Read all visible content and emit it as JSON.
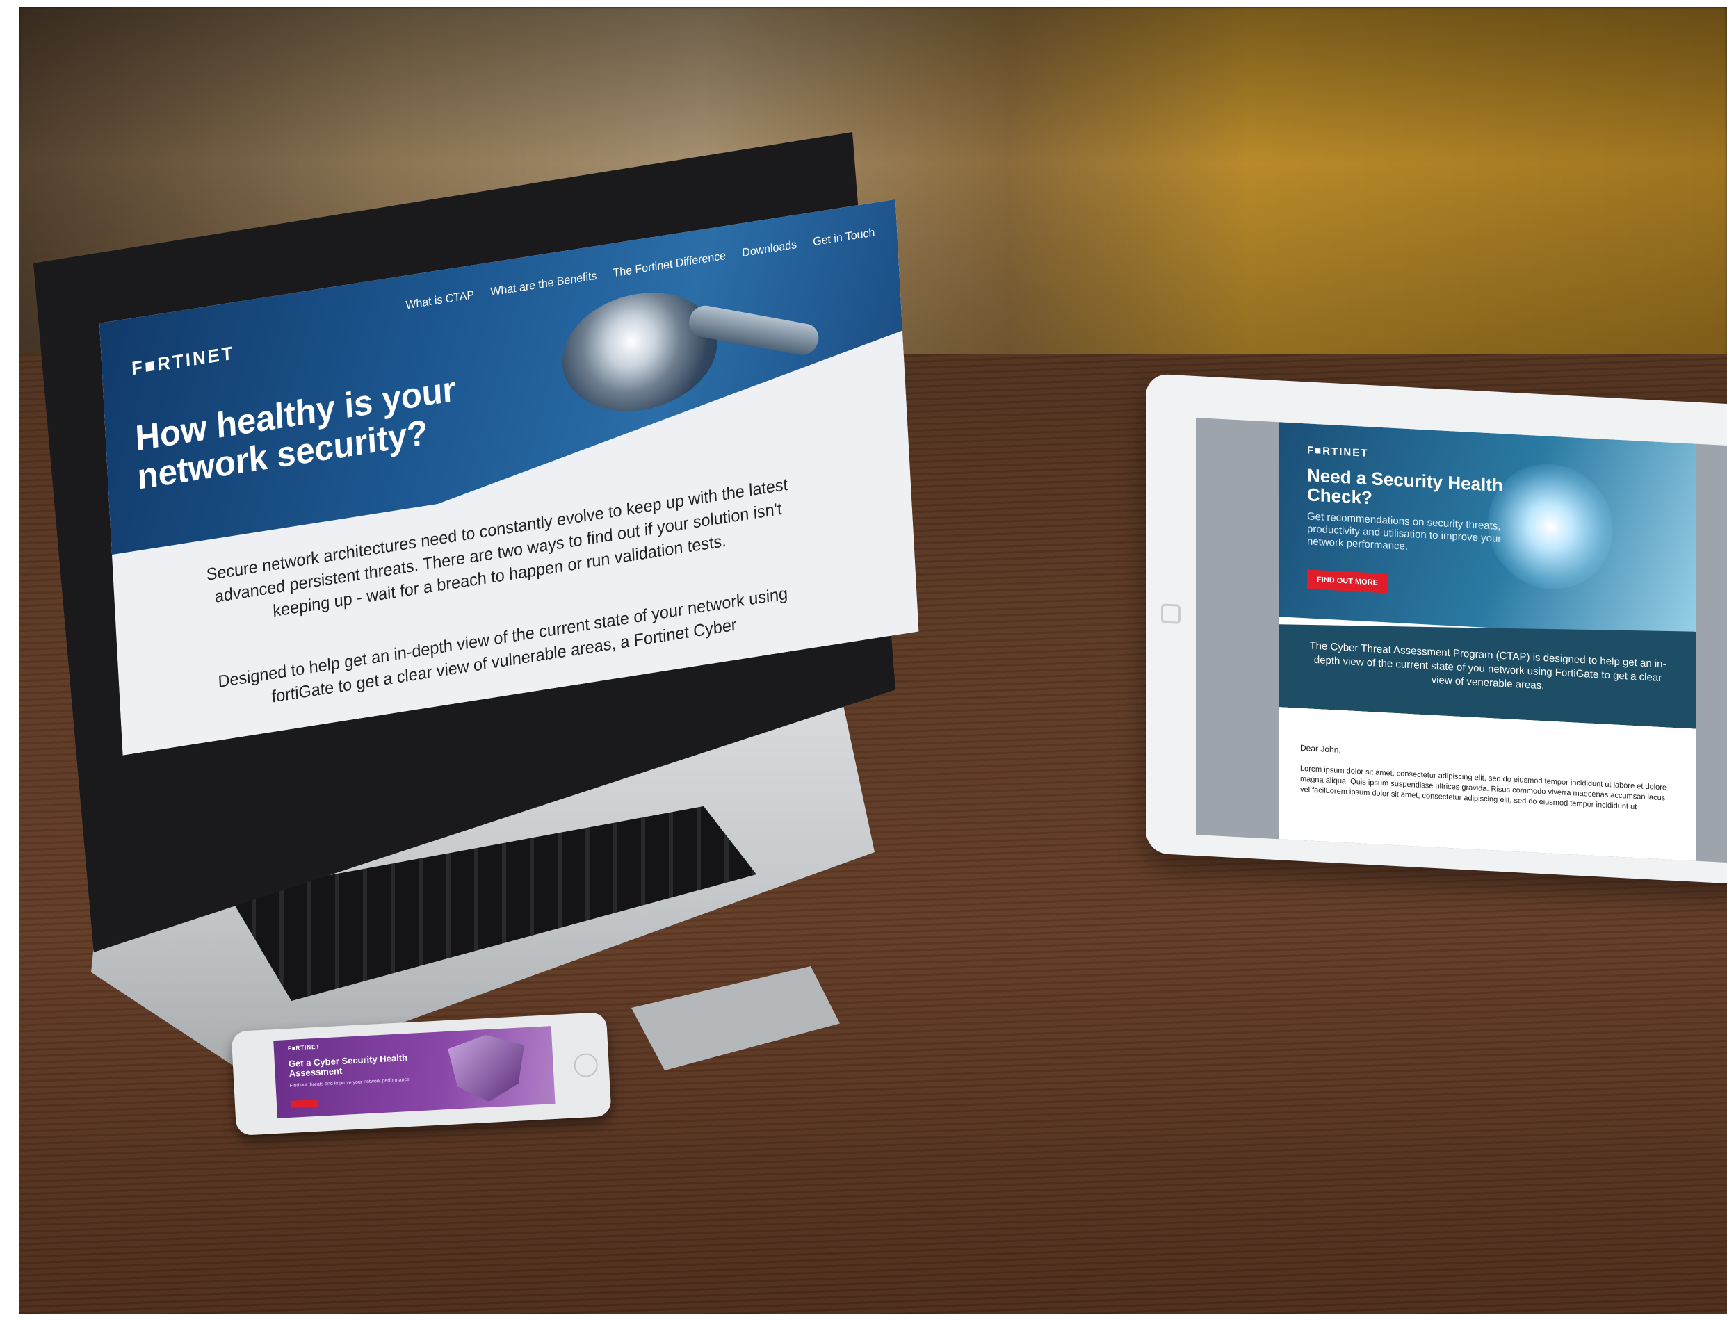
{
  "laptop": {
    "logo": "F■RTINET",
    "nav": [
      "What is CTAP",
      "What are the Benefits",
      "The Fortinet Difference",
      "Downloads",
      "Get in Touch"
    ],
    "title": "How healthy is your network security?",
    "paragraph1": "Secure network architectures need to constantly evolve to keep up with the latest advanced persistent threats. There are two ways to find out if your solution isn't keeping up - wait for a breach to happen or run validation tests.",
    "paragraph2": "Designed to help get an in-depth view of the current state of your network using fortiGate to get a clear view of vulnerable areas, a Fortinet Cyber"
  },
  "tablet": {
    "logo": "F■RTINET",
    "title": "Need a Security Health Check?",
    "subtitle": "Get recommendations on security threats, productivity and utilisation to improve your network performance.",
    "cta": "FIND OUT MORE",
    "band_text": "The Cyber Threat Assessment Program (CTAP) is designed to help get an in-depth view of the current state of you network using FortiGate to get a clear view of venerable areas.",
    "greeting": "Dear John,",
    "lorem": "Lorem ipsum dolor sit amet, consectetur adipiscing elit, sed do eiusmod tempor incididunt ut labore et dolore magna aliqua. Quis ipsum suspendisse ultrices gravida. Risus commodo viverra maecenas accumsan lacus vel facilLorem ipsum dolor sit amet, consectetur adipiscing elit, sed do eiusmod tempor incididunt ut"
  },
  "phone": {
    "logo": "F■RTINET",
    "title": "Get a Cyber Security Health Assessment",
    "subtitle": "Find out threats and improve your network performance"
  }
}
